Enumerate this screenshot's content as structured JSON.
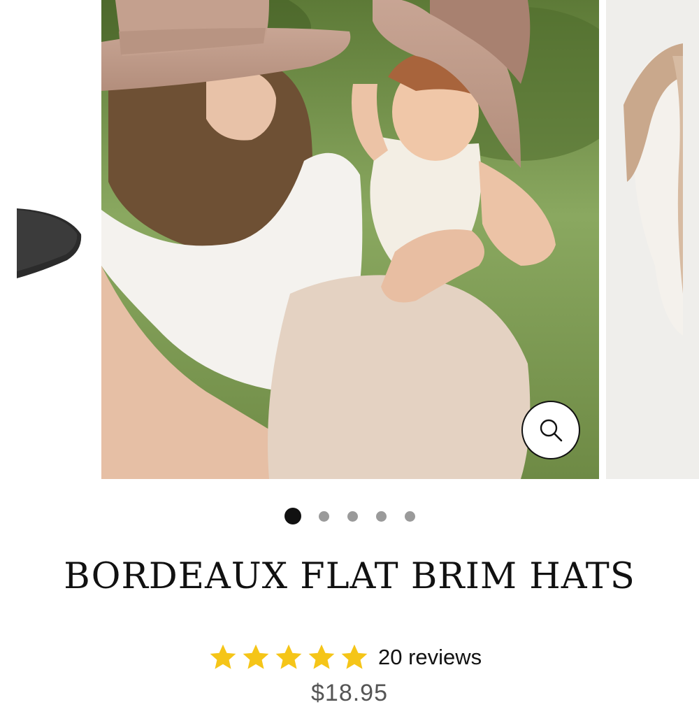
{
  "gallery": {
    "slides": [
      {
        "label": "Previous slide",
        "role": "prev"
      },
      {
        "label": "Main slide",
        "role": "main"
      },
      {
        "label": "Next slide",
        "role": "next"
      }
    ],
    "zoom_icon": "magnifier-icon"
  },
  "pagination": {
    "count": 5,
    "active_index": 0
  },
  "product": {
    "title": "BORDEAUX FLAT BRIM HATS",
    "rating": {
      "stars": 5,
      "reviews_label": "20 reviews",
      "star_color": "#f5c518"
    },
    "price": "$18.95"
  }
}
